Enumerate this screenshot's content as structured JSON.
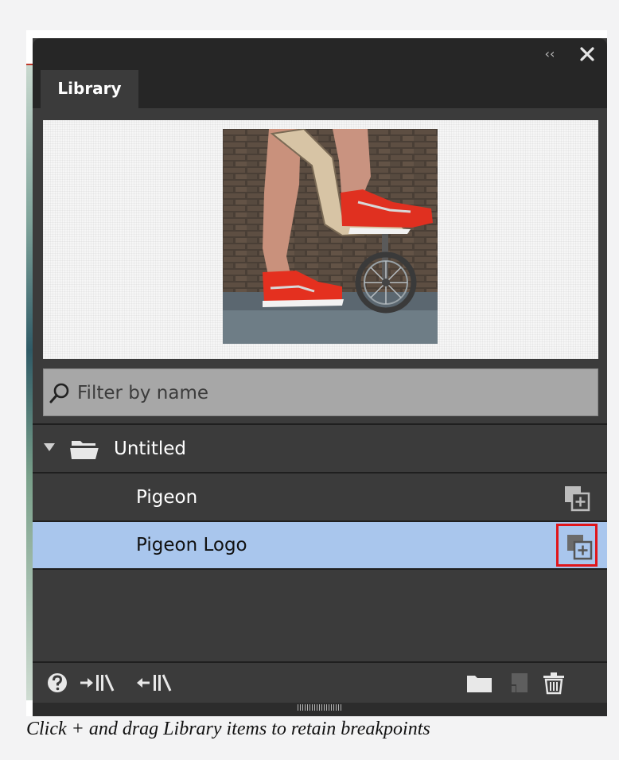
{
  "panel": {
    "tab_label": "Library",
    "filter_placeholder": "Filter by name",
    "group": {
      "label": "Untitled",
      "expanded": true
    },
    "items": [
      {
        "label": "Pigeon",
        "selected": false
      },
      {
        "label": "Pigeon Logo",
        "selected": true
      }
    ],
    "icons": {
      "collapse": "double-chevron-left-icon",
      "close": "close-icon",
      "search": "search-icon",
      "disclosure": "triangle-down-icon",
      "folder": "folder-icon",
      "add": "add-to-page-icon",
      "help": "help-icon",
      "export": "export-to-library-icon",
      "import": "import-from-library-icon",
      "new_folder": "new-folder-icon",
      "new_item": "new-item-icon",
      "delete": "trash-icon"
    },
    "colors": {
      "selection": "#a9c6ed",
      "highlight_border": "#e0151a",
      "panel_bg": "#3b3b3b"
    }
  },
  "caption": "Click + and drag Library items to retain breakpoints"
}
